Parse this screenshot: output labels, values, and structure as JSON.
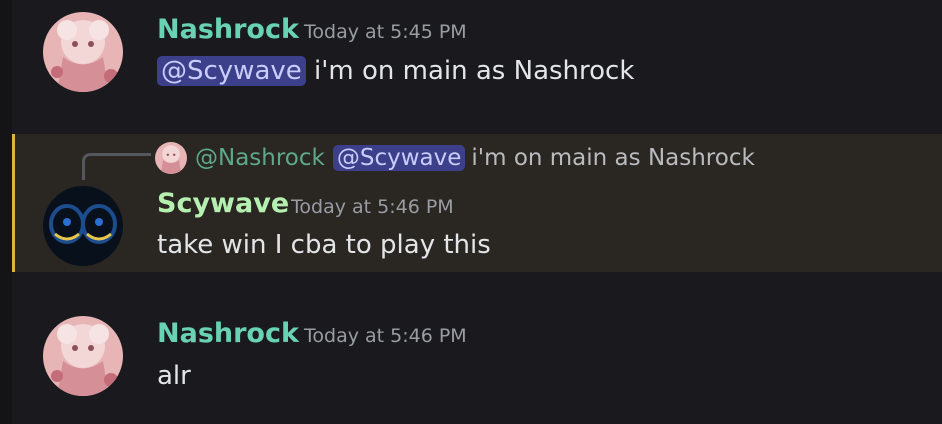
{
  "theme": {
    "accent_highlight": "#e0b33d",
    "nashrock_color": "#69d2b0",
    "scywave_color": "#b6f0b0"
  },
  "messages": [
    {
      "username": "Nashrock",
      "timestamp": "Today at 5:45 PM",
      "mention": "@Scywave",
      "text": " i'm on main as Nashrock",
      "avatar_icon": "anime-avatar-icon"
    },
    {
      "reply": {
        "username": "@Nashrock",
        "mention": "@Scywave",
        "text": "i'm on main as Nashrock"
      },
      "username": "Scywave",
      "timestamp": "Today at 5:46 PM",
      "text": "take win I cba to play this",
      "avatar_icon": "dark-pattern-avatar-icon"
    },
    {
      "username": "Nashrock",
      "timestamp": "Today at 5:46 PM",
      "text": "alr",
      "avatar_icon": "anime-avatar-icon"
    }
  ]
}
